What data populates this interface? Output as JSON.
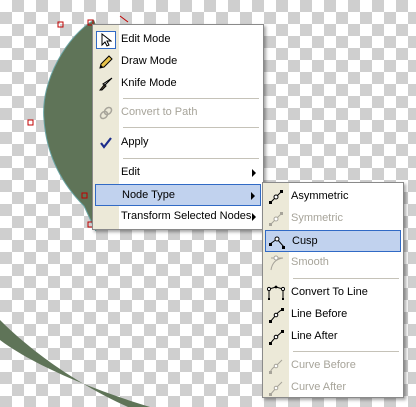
{
  "context_menu": {
    "items": [
      {
        "label": "Edit Mode",
        "icon": "arrow-pointer-icon"
      },
      {
        "label": "Draw Mode",
        "icon": "pencil-icon"
      },
      {
        "label": "Knife Mode",
        "icon": "knife-icon"
      },
      {
        "label": "Convert to Path",
        "icon": "path-links-icon",
        "disabled": true
      },
      {
        "label": "Apply",
        "icon": "checkmark-icon"
      },
      {
        "label": "Edit",
        "submenu": true
      },
      {
        "label": "Node Type",
        "submenu": true,
        "highlighted": true
      },
      {
        "label": "Transform Selected Nodes",
        "submenu": true
      }
    ]
  },
  "node_type_submenu": {
    "items": [
      {
        "label": "Asymmetric",
        "icon": "asymmetric-node-icon"
      },
      {
        "label": "Symmetric",
        "icon": "symmetric-node-icon",
        "disabled": true
      },
      {
        "label": "Cusp",
        "icon": "cusp-node-icon",
        "highlighted": true
      },
      {
        "label": "Smooth",
        "icon": "smooth-node-icon",
        "disabled": true
      },
      {
        "label": "Convert To Line",
        "icon": "convert-to-line-icon"
      },
      {
        "label": "Line Before",
        "icon": "line-before-icon"
      },
      {
        "label": "Line After",
        "icon": "line-after-icon"
      },
      {
        "label": "Curve Before",
        "icon": "curve-before-icon",
        "disabled": true
      },
      {
        "label": "Curve After",
        "icon": "curve-after-icon",
        "disabled": true
      }
    ]
  },
  "colors": {
    "shape_fill": "#5f7458",
    "canvas_check": "#cfcfcf",
    "menu_gutter": "#ece9d8",
    "highlight_fill": "#c1d2ee",
    "highlight_border": "#316ac5",
    "disabled_text": "#a7a49a",
    "selection_marker": "#c00000"
  }
}
